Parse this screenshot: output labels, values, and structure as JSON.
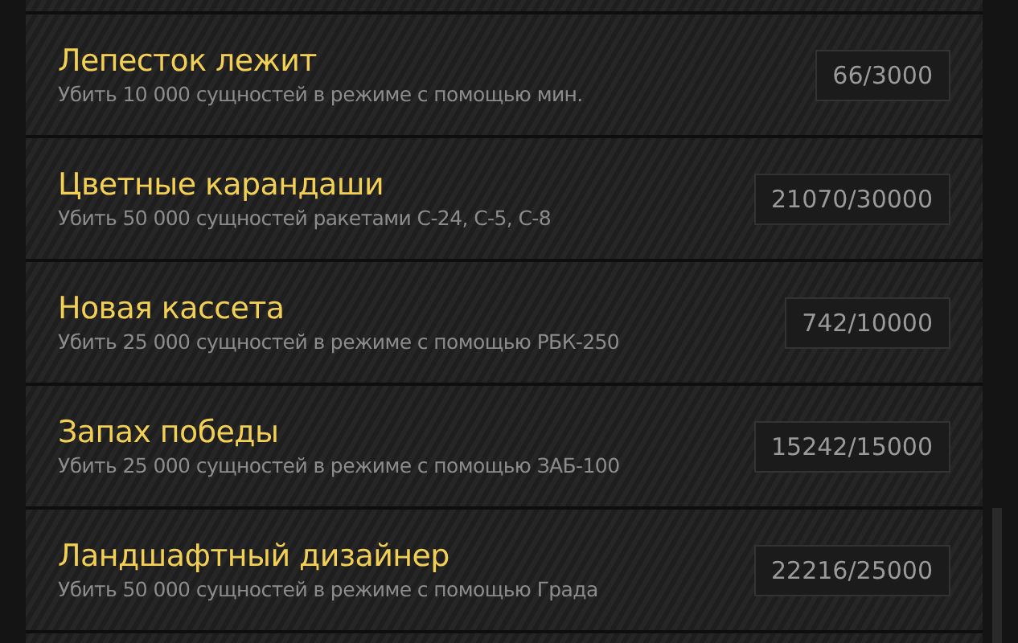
{
  "achievements": [
    {
      "title": "Лепесток лежит",
      "description": "Убить 10 000 сущностей в режиме с помощью мин.",
      "progress": "66/3000"
    },
    {
      "title": "Цветные карандаши",
      "description": "Убить 50 000 сущностей ракетами С-24, С-5, С-8",
      "progress": "21070/30000"
    },
    {
      "title": "Новая кассета",
      "description": "Убить 25 000 сущностей в режиме с помощью РБК-250",
      "progress": "742/10000"
    },
    {
      "title": "Запах победы",
      "description": "Убить 25 000 сущностей в режиме с помощью ЗАБ-100",
      "progress": "15242/15000"
    },
    {
      "title": "Ландшафтный дизайнер",
      "description": "Убить 50 000 сущностей в режиме с помощью Града",
      "progress": "22216/25000"
    }
  ]
}
